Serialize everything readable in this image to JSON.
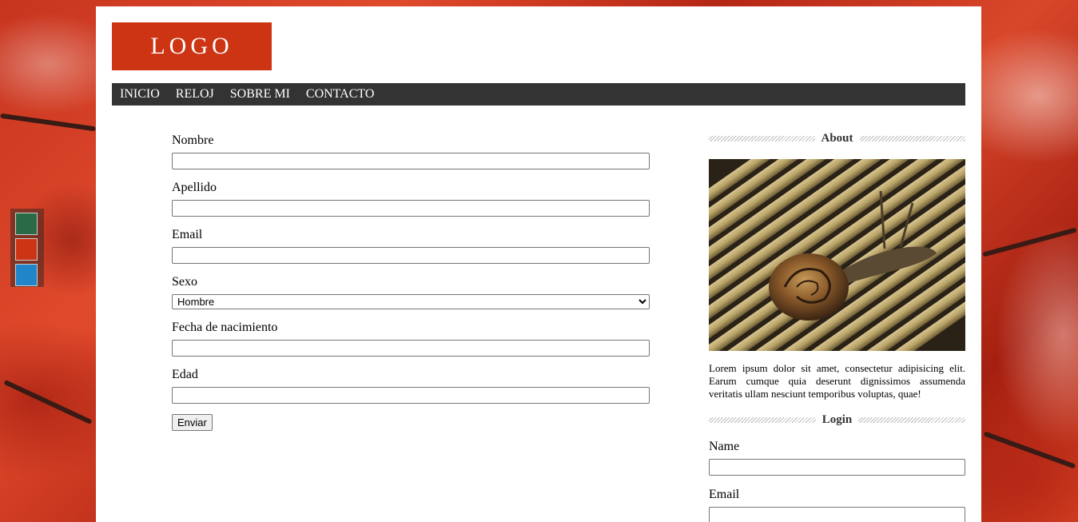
{
  "logo": "LOGO",
  "nav": [
    "INICIO",
    "RELOJ",
    "SOBRE MI",
    "CONTACTO"
  ],
  "form": {
    "nombre_label": "Nombre",
    "apellido_label": "Apellido",
    "email_label": "Email",
    "sexo_label": "Sexo",
    "sexo_selected": "Hombre",
    "fecha_label": "Fecha de nacimiento",
    "edad_label": "Edad",
    "submit_label": "Enviar"
  },
  "sidebar": {
    "about_title": "About",
    "about_text": "Lorem ipsum dolor sit amet, consectetur adipisicing elit. Earum cumque quia deserunt dignissimos assumenda veritatis ullam nesciunt temporibus voluptas, quae!",
    "login_title": "Login",
    "login_name_label": "Name",
    "login_email_label": "Email"
  },
  "theme_swatches": [
    "#2a6b45",
    "#cc3414",
    "#2185c9"
  ]
}
